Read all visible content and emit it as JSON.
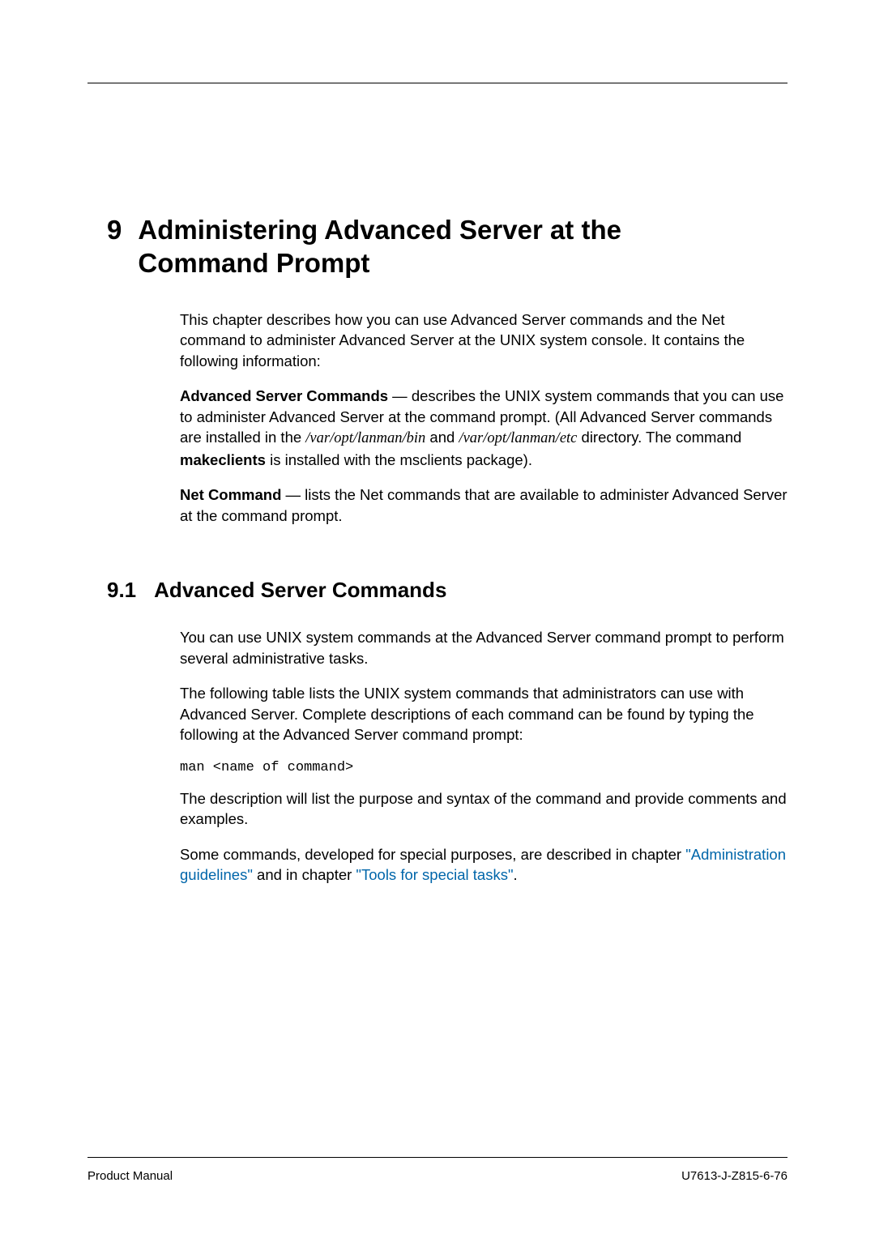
{
  "chapter": {
    "number": "9",
    "title_line1": "Administering Advanced Server at the",
    "title_line2": "Command Prompt"
  },
  "intro": {
    "p1": "This chapter describes how you can use Advanced Server commands and the Net command to administer Advanced Server at the UNIX system console. It contains the following information:",
    "p2_bold": "Advanced Server Commands",
    "p2_rest_a": " — describes the UNIX system commands that you can use to administer Advanced Server at the command prompt. (All Advanced Server commands are installed in the ",
    "p2_path1": "/var/opt/lanman/bin",
    "p2_and": " and ",
    "p2_path2": "/var/opt/lanman/etc",
    "p2_rest_b": " directory. The command ",
    "p2_bold2": "makeclients",
    "p2_rest_c": " is installed with the msclients package).",
    "p3_bold": "Net Command",
    "p3_rest": " — lists the Net commands that are available to administer Advanced Server at the command prompt."
  },
  "section": {
    "number": "9.1",
    "title": "Advanced Server Commands",
    "p1": "You can use UNIX system commands at the Advanced Server command prompt to perform several administrative tasks.",
    "p2": "The following table lists the UNIX system commands that administrators can use with Advanced Server. Complete descriptions of each command can be found by typing the following at the Advanced Server command prompt:",
    "code": "man <name of command>",
    "p3": "The description will list the purpose and syntax of the command and provide comments and examples.",
    "p4_a": "Some commands, developed for special purposes, are described in chapter ",
    "p4_link1": "\"Administration guidelines\"",
    "p4_b": " and in chapter ",
    "p4_link2": "\"Tools for special tasks\"",
    "p4_c": "."
  },
  "footer": {
    "left": "Product Manual",
    "right": "U7613-J-Z815-6-76"
  }
}
